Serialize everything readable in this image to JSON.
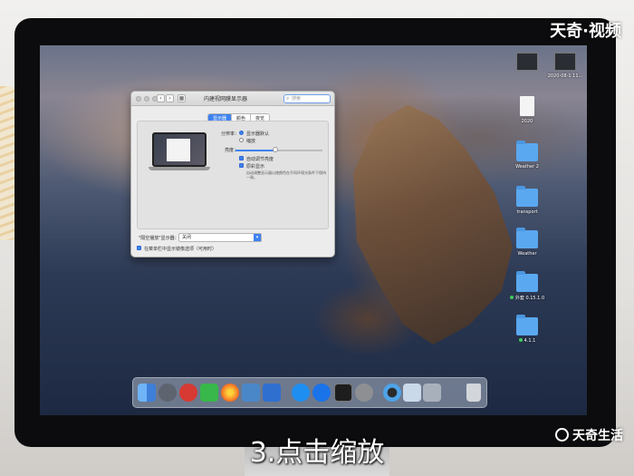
{
  "window": {
    "title": "内建视网膜显示器",
    "search_placeholder": "搜索",
    "tabs": [
      "显示器",
      "颜色",
      "夜览"
    ],
    "resolution_label": "分辨率：",
    "resolution_options": [
      "显示器默认",
      "缩放"
    ],
    "brightness_label": "亮度：",
    "brightness_level": 0.46,
    "auto_brightness_label": "自动调节亮度",
    "true_tone_label": "原彩显示",
    "true_tone_desc": "自动调整显示器以使颜色在不同环境光条件下保持一致。",
    "airplay_label": "\"隔空播放\"显示器：",
    "airplay_value": "关闭",
    "mirror_option_label": "在菜单栏中显示镜像选项（可用时）"
  },
  "desktop": {
    "icons": [
      {
        "name": "screenshot-file",
        "label": "",
        "kind": "thumb"
      },
      {
        "name": "screenshot-file-2",
        "label": "2020-08-1 11...",
        "kind": "thumb"
      },
      {
        "name": "document-file",
        "label": "2020",
        "kind": "doc"
      },
      {
        "name": "folder-weather-2",
        "label": "Weather 2",
        "kind": "folder"
      },
      {
        "name": "folder-transport",
        "label": "transport",
        "kind": "folder"
      },
      {
        "name": "folder-weather",
        "label": "Weather",
        "kind": "folder"
      },
      {
        "name": "folder-tag",
        "label": "外套 0.15.1.0",
        "kind": "folder"
      },
      {
        "name": "folder-411",
        "label": "4.1.1",
        "kind": "folder"
      }
    ]
  },
  "dock": {
    "items": [
      "finder",
      "launchpad",
      "netease-music",
      "wechat",
      "firefox",
      "xcode-tools",
      "notes",
      "app-store",
      "downloads",
      "terminal",
      "system-preferences",
      "quicktime",
      "preview",
      "photos",
      "trash"
    ]
  },
  "caption": "3.点击缩放",
  "watermark_top": "天奇·视频",
  "watermark_bottom": "天奇生活",
  "colors": {
    "accent": "#3f82f0",
    "folder": "#5aa8f0"
  }
}
